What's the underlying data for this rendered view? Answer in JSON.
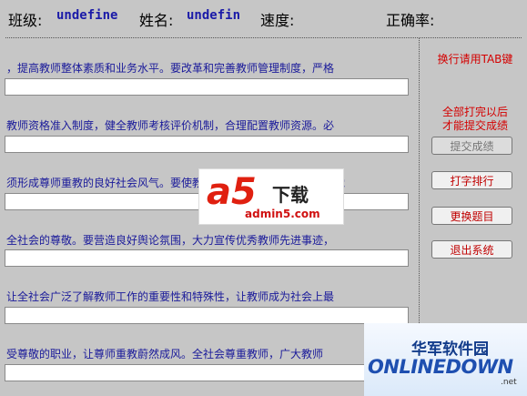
{
  "header": {
    "class_label": "班级:",
    "class_value": "undefine",
    "name_label": "姓名:",
    "name_value": "undefin",
    "speed_label": "速度:",
    "accuracy_label": "正确率:"
  },
  "rows": [
    {
      "text": "，提高教师整体素质和业务水平。要改革和完善教师管理制度，严格",
      "input": ""
    },
    {
      "text": "教师资格准入制度，健全教师考核评价机制，合理配置教师资源。必",
      "input": ""
    },
    {
      "text": "须形成尊师重教的良好社会风气。要使教师职业成为令人羡慕受到全党",
      "input": ""
    },
    {
      "text": "全社会的尊敬。要营造良好舆论氛围，大力宣传优秀教师先进事迹，",
      "input": ""
    },
    {
      "text": "让全社会广泛了解教师工作的重要性和特殊性，让教师成为社会上最",
      "input": ""
    },
    {
      "text": "受尊敬的职业，让尊师重教蔚然成风。全社会尊重教师，广大教师",
      "input": ""
    }
  ],
  "side": {
    "tab_hint": "换行请用TAB键",
    "submit_hint_1": "全部打完以后",
    "submit_hint_2": "才能提交成绩",
    "submit_label": "提交成绩",
    "rank_label": "打字排行",
    "change_label": "更换题目",
    "exit_label": "退出系统"
  },
  "watermarks": {
    "a5_logo": "a5",
    "a5_cn": "下载",
    "a5_url": "admin5.com",
    "od_cn": "华军软件园",
    "od_en": "ONLINEDOWN",
    "od_suffix": ".net"
  }
}
